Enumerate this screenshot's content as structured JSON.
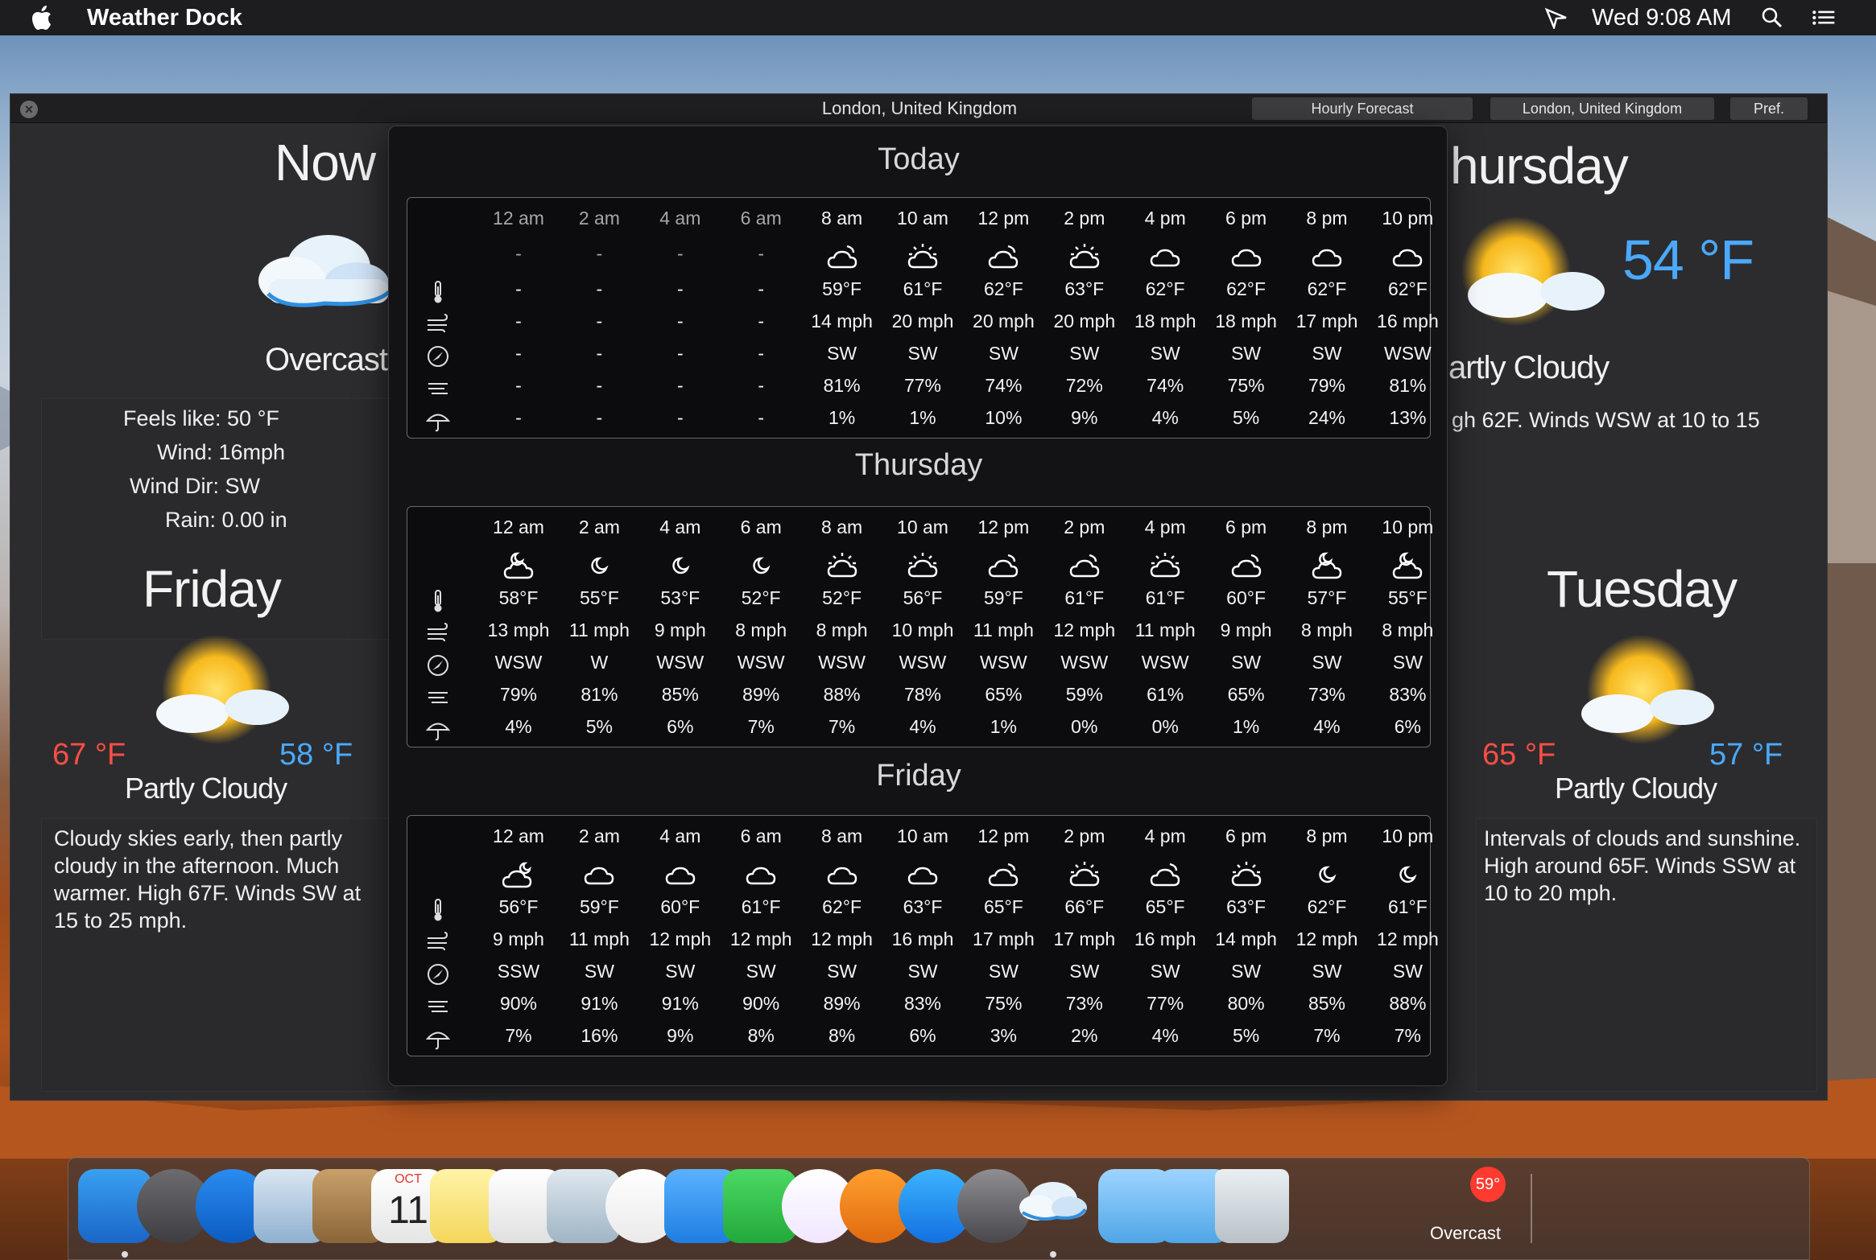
{
  "menubar": {
    "app_name": "Weather Dock",
    "clock": "Wed 9:08 AM"
  },
  "window": {
    "title": "London, United Kingdom",
    "buttons": {
      "hourly": "Hourly Forecast",
      "location": "London, United Kingdom",
      "prefs": "Pref."
    }
  },
  "now": {
    "heading": "Now",
    "condition": "Overcast",
    "feels_like": "Feels like: 50 °F",
    "wind": "Wind: 16mph",
    "wind_dir": "Wind Dir: SW",
    "rain": "Rain: 0.00 in"
  },
  "thursday_panel": {
    "heading": "hursday",
    "temp": "54 °F",
    "condition": "artly Cloudy",
    "desc": "gh 62F. Winds WSW at 10 to 15"
  },
  "friday_panel": {
    "heading": "Friday",
    "hi": "67 °F",
    "lo": "58 °F",
    "condition": "Partly Cloudy",
    "desc": "Cloudy skies early, then partly cloudy in the afternoon. Much warmer. High 67F. Winds SW at 15 to 25 mph."
  },
  "tuesday_panel": {
    "heading": "Tuesday",
    "hi": "65 °F",
    "lo": "57 °F",
    "condition": "Partly Cloudy",
    "desc": "Intervals of clouds and sunshine. High around 65F. Winds SSW at 10 to 20 mph."
  },
  "hourly": [
    {
      "day": "Today",
      "hours": [
        "12 am",
        "2 am",
        "4 am",
        "6 am",
        "8 am",
        "10 am",
        "12 pm",
        "2 pm",
        "4 pm",
        "6 pm",
        "8 pm",
        "10 pm"
      ],
      "icons": [
        "none",
        "none",
        "none",
        "none",
        "cloud-sun",
        "sun-cloud",
        "cloud-sun",
        "sun-cloud",
        "cloud",
        "cloud",
        "cloud",
        "cloud"
      ],
      "temps": [
        "-",
        "-",
        "-",
        "-",
        "59°F",
        "61°F",
        "62°F",
        "63°F",
        "62°F",
        "62°F",
        "62°F",
        "62°F"
      ],
      "wind": [
        "-",
        "-",
        "-",
        "-",
        "14 mph",
        "20 mph",
        "20 mph",
        "20 mph",
        "18 mph",
        "18 mph",
        "17 mph",
        "16 mph"
      ],
      "dir": [
        "-",
        "-",
        "-",
        "-",
        "SW",
        "SW",
        "SW",
        "SW",
        "SW",
        "SW",
        "SW",
        "WSW"
      ],
      "humidity": [
        "-",
        "-",
        "-",
        "-",
        "81%",
        "77%",
        "74%",
        "72%",
        "74%",
        "75%",
        "79%",
        "81%"
      ],
      "precip": [
        "-",
        "-",
        "-",
        "-",
        "1%",
        "1%",
        "10%",
        "9%",
        "4%",
        "5%",
        "24%",
        "13%"
      ]
    },
    {
      "day": "Thursday",
      "hours": [
        "12 am",
        "2 am",
        "4 am",
        "6 am",
        "8 am",
        "10 am",
        "12 pm",
        "2 pm",
        "4 pm",
        "6 pm",
        "8 pm",
        "10 pm"
      ],
      "icons": [
        "moon-cloud",
        "moon",
        "moon",
        "moon",
        "sun-cloud",
        "sun-cloud",
        "cloud-sun",
        "cloud-sun",
        "sun-cloud",
        "cloud-sun",
        "moon-cloud",
        "moon-cloud"
      ],
      "temps": [
        "58°F",
        "55°F",
        "53°F",
        "52°F",
        "52°F",
        "56°F",
        "59°F",
        "61°F",
        "61°F",
        "60°F",
        "57°F",
        "55°F"
      ],
      "wind": [
        "13 mph",
        "11 mph",
        "9 mph",
        "8 mph",
        "8 mph",
        "10 mph",
        "11 mph",
        "12 mph",
        "11 mph",
        "9 mph",
        "8 mph",
        "8 mph"
      ],
      "dir": [
        "WSW",
        "W",
        "WSW",
        "WSW",
        "WSW",
        "WSW",
        "WSW",
        "WSW",
        "WSW",
        "SW",
        "SW",
        "SW"
      ],
      "humidity": [
        "79%",
        "81%",
        "85%",
        "89%",
        "88%",
        "78%",
        "65%",
        "59%",
        "61%",
        "65%",
        "73%",
        "83%"
      ],
      "precip": [
        "4%",
        "5%",
        "6%",
        "7%",
        "7%",
        "4%",
        "1%",
        "0%",
        "0%",
        "1%",
        "4%",
        "6%"
      ]
    },
    {
      "day": "Friday",
      "hours": [
        "12 am",
        "2 am",
        "4 am",
        "6 am",
        "8 am",
        "10 am",
        "12 pm",
        "2 pm",
        "4 pm",
        "6 pm",
        "8 pm",
        "10 pm"
      ],
      "icons": [
        "cloud-moon",
        "cloud",
        "cloud",
        "cloud",
        "cloud",
        "cloud",
        "cloud-sun",
        "sun-cloud",
        "cloud-sun",
        "sun-cloud",
        "moon",
        "moon"
      ],
      "temps": [
        "56°F",
        "59°F",
        "60°F",
        "61°F",
        "62°F",
        "63°F",
        "65°F",
        "66°F",
        "65°F",
        "63°F",
        "62°F",
        "61°F"
      ],
      "wind": [
        "9 mph",
        "11 mph",
        "12 mph",
        "12 mph",
        "12 mph",
        "16 mph",
        "17 mph",
        "17 mph",
        "16 mph",
        "14 mph",
        "12 mph",
        "12 mph"
      ],
      "dir": [
        "SSW",
        "SW",
        "SW",
        "SW",
        "SW",
        "SW",
        "SW",
        "SW",
        "SW",
        "SW",
        "SW",
        "SW"
      ],
      "humidity": [
        "90%",
        "91%",
        "91%",
        "90%",
        "89%",
        "83%",
        "75%",
        "73%",
        "77%",
        "80%",
        "85%",
        "88%"
      ],
      "precip": [
        "7%",
        "16%",
        "9%",
        "8%",
        "8%",
        "6%",
        "3%",
        "2%",
        "4%",
        "5%",
        "7%",
        "7%"
      ]
    }
  ],
  "dock": {
    "items": [
      "finder",
      "launchpad",
      "safari",
      "mail",
      "contacts",
      "calendar",
      "notes",
      "reminders",
      "preview",
      "photos",
      "messages",
      "facetime",
      "itunes",
      "ibooks",
      "app-store",
      "system-preferences",
      "weather-dock",
      "downloads-folder",
      "applications-folder",
      "trash"
    ],
    "calendar_month": "OCT",
    "calendar_day": "11",
    "weather_badge": "59°",
    "weather_label": "Overcast"
  }
}
